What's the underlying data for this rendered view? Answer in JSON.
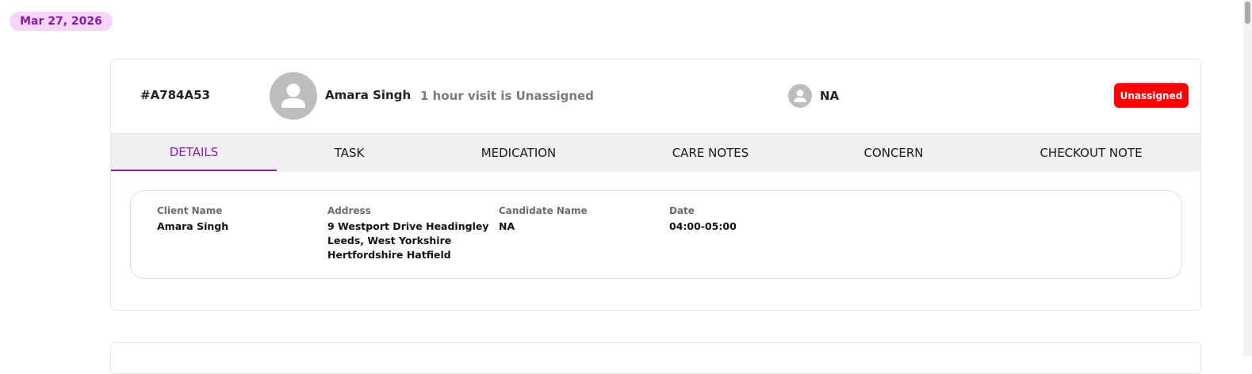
{
  "date_pill": "Mar 27, 2026",
  "visit": {
    "id": "#A784A53",
    "client_name": "Amara Singh",
    "description": "1 hour visit is Unassigned",
    "carer_name": "NA",
    "status": "Unassigned"
  },
  "tabs": [
    {
      "label": "DETAILS",
      "active": true
    },
    {
      "label": "TASK",
      "active": false
    },
    {
      "label": "MEDICATION",
      "active": false
    },
    {
      "label": "CARE NOTES",
      "active": false
    },
    {
      "label": "CONCERN",
      "active": false
    },
    {
      "label": "CHECKOUT NOTE",
      "active": false
    }
  ],
  "details": {
    "client_name_label": "Client Name",
    "client_name_value": "Amara Singh",
    "address_label": "Address",
    "address_line1": "9 Westport Drive Headingley",
    "address_line2": "Leeds, West Yorkshire",
    "address_line3": "Hertfordshire Hatfield",
    "candidate_label": "Candidate Name",
    "candidate_value": "NA",
    "date_label": "Date",
    "date_value": "04:00-05:00"
  },
  "colors": {
    "accent": "#8a1aa6",
    "pill_bg": "#f7d4f9",
    "status_red": "#ff0000",
    "avatar_grey": "#bdbdbd"
  },
  "icons": {
    "client_avatar": "user-avatar-icon",
    "carer_avatar": "user-avatar-icon"
  }
}
